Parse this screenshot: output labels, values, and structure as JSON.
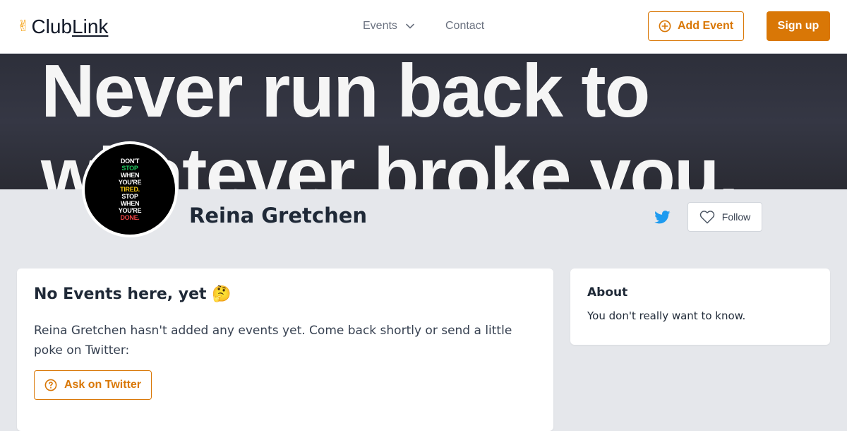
{
  "header": {
    "logo": {
      "emoji": "✌",
      "part1": "Club",
      "part2": "Link"
    },
    "nav": {
      "events_label": "Events",
      "contact_label": "Contact"
    },
    "add_event_label": "Add Event",
    "signup_label": "Sign up"
  },
  "profile": {
    "banner_text_line1": "Never run back to",
    "banner_text_line2": "whatever broke you.",
    "avatar_poster": [
      "DON'T",
      "STOP",
      "WHEN",
      "YOU'RE",
      "TIRED.",
      "STOP",
      "WHEN",
      "YOU'RE",
      "DONE."
    ],
    "name": "Reina Gretchen",
    "follow_label": "Follow"
  },
  "events": {
    "title": "No Events here, yet",
    "title_emoji": "🤔",
    "message": "Reina Gretchen hasn't added any events yet. Come back shortly or send a little poke on Twitter:",
    "ask_label": "Ask on Twitter"
  },
  "about": {
    "title": "About",
    "text": "You don't really want to know."
  },
  "colors": {
    "accent": "#d97706",
    "twitter": "#1d9bf0",
    "page_bg": "#e5e7eb"
  }
}
